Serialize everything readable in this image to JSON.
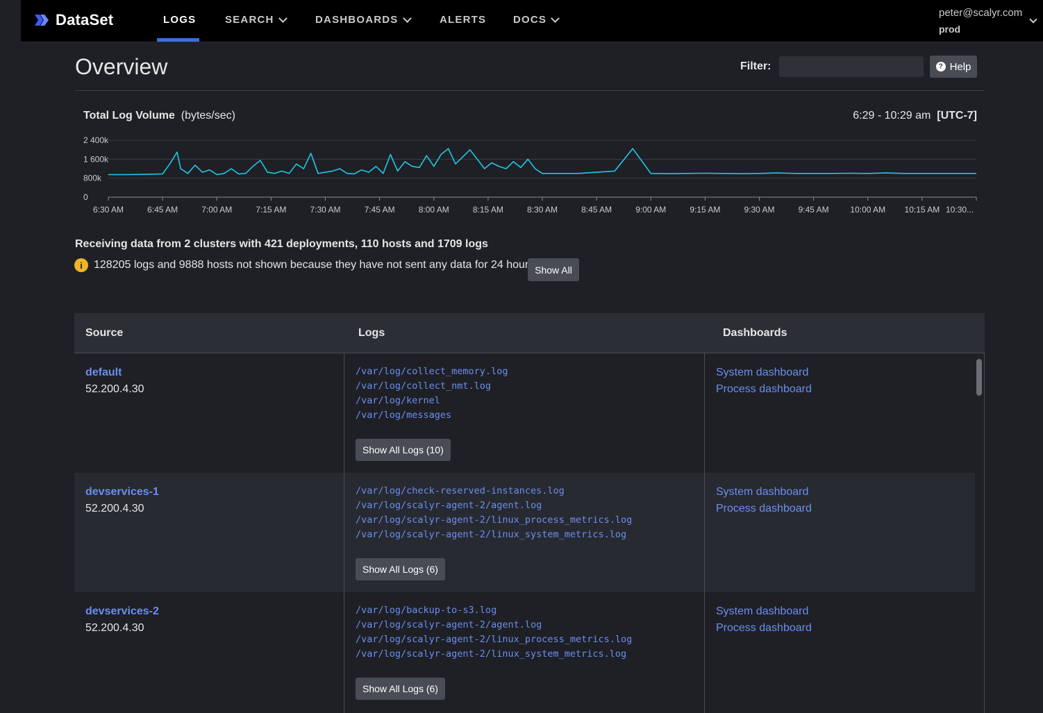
{
  "nav": {
    "brand": "DataSet",
    "items": [
      {
        "label": "LOGS",
        "active": true,
        "dropdown": false
      },
      {
        "label": "SEARCH",
        "active": false,
        "dropdown": true
      },
      {
        "label": "DASHBOARDS",
        "active": false,
        "dropdown": true
      },
      {
        "label": "ALERTS",
        "active": false,
        "dropdown": false
      },
      {
        "label": "DOCS",
        "active": false,
        "dropdown": true
      }
    ],
    "user_email": "peter@scalyr.com",
    "user_env": "prod"
  },
  "header": {
    "title": "Overview",
    "filter_label": "Filter:",
    "filter_value": "",
    "help_label": "Help",
    "help_icon": "question-circle-icon"
  },
  "chart_header": {
    "title": "Total Log Volume",
    "unit": "(bytes/sec)",
    "range": "6:29 - 10:29 am",
    "timezone": "[UTC-7]"
  },
  "chart_data": {
    "type": "line",
    "title": "Total Log Volume",
    "ylabel": "(bytes/sec)",
    "ylim": [
      0,
      2400000
    ],
    "yticks": [
      {
        "value": 0,
        "label": "0"
      },
      {
        "value": 800000,
        "label": "800k"
      },
      {
        "value": 1600000,
        "label": "1 600k"
      },
      {
        "value": 2400000,
        "label": "2 400k"
      }
    ],
    "xticks": [
      "6:30 AM",
      "6:45 AM",
      "7:00 AM",
      "7:15 AM",
      "7:30 AM",
      "7:45 AM",
      "8:00 AM",
      "8:15 AM",
      "8:30 AM",
      "8:45 AM",
      "9:00 AM",
      "9:15 AM",
      "9:30 AM",
      "9:45 AM",
      "10:00 AM",
      "10:15 AM",
      "10:30..."
    ],
    "grid": true,
    "series": [
      {
        "color": "#22c7e8",
        "x_minutes_from_630": [
          0,
          5,
          10,
          15,
          17,
          19,
          20,
          22,
          24,
          26,
          28,
          30,
          32,
          34,
          36,
          38,
          40,
          42,
          44,
          46,
          48,
          50,
          52,
          54,
          56,
          58,
          60,
          62,
          64,
          66,
          68,
          70,
          72,
          74,
          76,
          78,
          80,
          82,
          84,
          86,
          88,
          90,
          92,
          94,
          96,
          98,
          100,
          102,
          104,
          106,
          108,
          110,
          112,
          114,
          116,
          118,
          120,
          125,
          130,
          135,
          140,
          145,
          150,
          155,
          160,
          165,
          170,
          175,
          180,
          185,
          190,
          195,
          200,
          205,
          210,
          215,
          220,
          225,
          230,
          235,
          240
        ],
        "values": [
          950000,
          950000,
          960000,
          980000,
          1400000,
          1900000,
          1200000,
          1000000,
          1350000,
          1050000,
          1150000,
          950000,
          1000000,
          1200000,
          980000,
          1000000,
          1300000,
          1550000,
          1050000,
          1000000,
          1100000,
          1000000,
          1400000,
          1200000,
          1850000,
          1000000,
          1050000,
          1100000,
          1200000,
          1000000,
          980000,
          1150000,
          1050000,
          1300000,
          1000000,
          1800000,
          1100000,
          1500000,
          1300000,
          1250000,
          1750000,
          1300000,
          1800000,
          2050000,
          1400000,
          1700000,
          2000000,
          1600000,
          1200000,
          1450000,
          1300000,
          1200000,
          1500000,
          1250000,
          1600000,
          1200000,
          1000000,
          1000000,
          1000000,
          1050000,
          1100000,
          2050000,
          1000000,
          990000,
          1000000,
          1010000,
          1000000,
          990000,
          1000000,
          1020000,
          1000000,
          1000000,
          1000000,
          1010000,
          1000000,
          1020000,
          1000000,
          1000000,
          1000000,
          1000000,
          1000000
        ]
      }
    ]
  },
  "summary": "Receiving data from 2 clusters with 421 deployments, 110 hosts and 1709 logs",
  "notice": {
    "icon": "info-icon",
    "text": "128205 logs and 9888 hosts not shown because they have not sent any data for 24 hours",
    "button": "Show All"
  },
  "table": {
    "headers": [
      "Source",
      "Logs",
      "Dashboards"
    ],
    "rows": [
      {
        "name": "default",
        "ip": "52.200.4.30",
        "logs": [
          "/var/log/collect_memory.log",
          "/var/log/collect_nmt.log",
          "/var/log/kernel",
          "/var/log/messages"
        ],
        "show_all": "Show All Logs (10)",
        "dashboards": [
          "System dashboard",
          "Process dashboard"
        ]
      },
      {
        "name": "devservices-1",
        "ip": "52.200.4.30",
        "logs": [
          "/var/log/check-reserved-instances.log",
          "/var/log/scalyr-agent-2/agent.log",
          "/var/log/scalyr-agent-2/linux_process_metrics.log",
          "/var/log/scalyr-agent-2/linux_system_metrics.log"
        ],
        "show_all": "Show All Logs (6)",
        "dashboards": [
          "System dashboard",
          "Process dashboard"
        ]
      },
      {
        "name": "devservices-2",
        "ip": "52.200.4.30",
        "logs": [
          "/var/log/backup-to-s3.log",
          "/var/log/scalyr-agent-2/agent.log",
          "/var/log/scalyr-agent-2/linux_process_metrics.log",
          "/var/log/scalyr-agent-2/linux_system_metrics.log"
        ],
        "show_all": "Show All Logs (6)",
        "dashboards": [
          "System dashboard",
          "Process dashboard"
        ]
      }
    ]
  }
}
